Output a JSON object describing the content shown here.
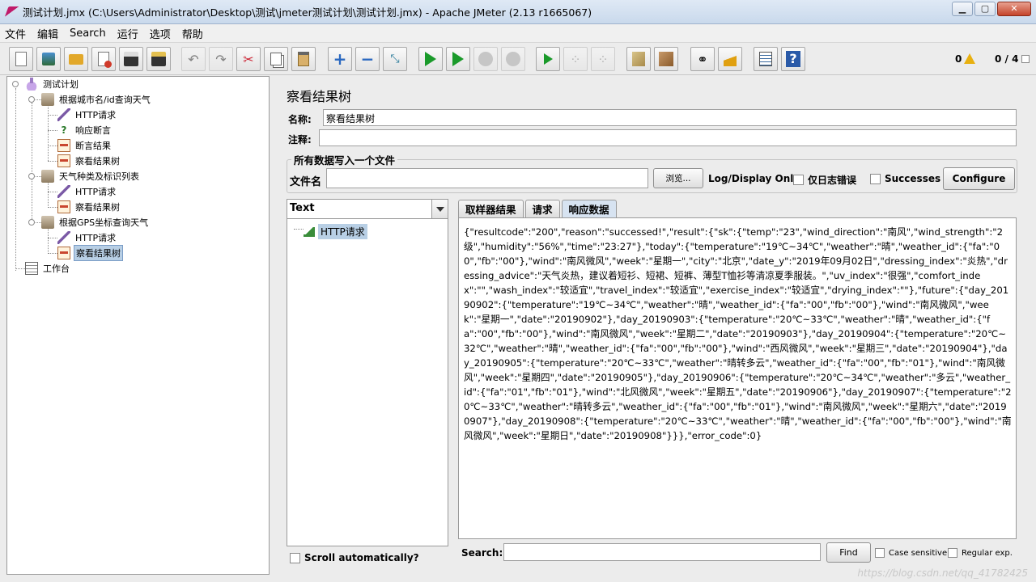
{
  "window": {
    "title": "测试计划.jmx (C:\\Users\\Administrator\\Desktop\\测试\\jmeter测试计划\\测试计划.jmx) - Apache JMeter (2.13 r1665067)",
    "min_label": "▁",
    "max_label": "▢",
    "close_label": "✕"
  },
  "menu": [
    "文件",
    "编辑",
    "Search",
    "运行",
    "选项",
    "帮助"
  ],
  "toolbar": {
    "buttons": [
      "new-icon",
      "templates-icon",
      "open-icon",
      "close-icon",
      "save-icon",
      "save-as-icon",
      "undo-icon",
      "redo-icon",
      "cut-icon",
      "copy-icon",
      "paste-icon",
      "expand-icon",
      "collapse-icon",
      "toggle-icon",
      "start-icon",
      "start-no-pause-icon",
      "stop-icon",
      "shutdown-icon",
      "remote-start-icon",
      "remote-stop-icon",
      "remote-shutdown-icon",
      "clear-icon",
      "clear-all-icon",
      "search-icon",
      "reset-search-icon",
      "function-helper-icon",
      "help-icon"
    ],
    "error_count": "0",
    "threads": "0 / 4"
  },
  "tree": {
    "plan": "测试计划",
    "group1": "根据城市名/id查询天气",
    "http1": "HTTP请求",
    "assert1": "响应断言",
    "assert_result1": "断言结果",
    "view1": "察看结果树",
    "group2": "天气种类及标识列表",
    "http2": "HTTP请求",
    "view2": "察看结果树",
    "group3": "根据GPS坐标查询天气",
    "http3": "HTTP请求",
    "view3": "察看结果树",
    "workbench": "工作台"
  },
  "panel": {
    "title": "察看结果树",
    "name_label": "名称:",
    "name_value": "察看结果树",
    "comment_label": "注释:",
    "comment_value": "",
    "file_group_title": "所有数据写入一个文件",
    "filename_label": "文件名",
    "filename_value": "",
    "browse_label": "浏览...",
    "log_only_label": "Log/Display Only:",
    "errors_only_label": "仅日志错误",
    "successes_label": "Successes",
    "configure_label": "Configure",
    "renderer": "Text",
    "sample_label": "HTTP请求",
    "tabs": [
      "取样器结果",
      "请求",
      "响应数据"
    ],
    "response_text": "{\"resultcode\":\"200\",\"reason\":\"successed!\",\"result\":{\"sk\":{\"temp\":\"23\",\"wind_direction\":\"南风\",\"wind_strength\":\"2级\",\"humidity\":\"56%\",\"time\":\"23:27\"},\"today\":{\"temperature\":\"19℃~34℃\",\"weather\":\"晴\",\"weather_id\":{\"fa\":\"00\",\"fb\":\"00\"},\"wind\":\"南风微风\",\"week\":\"星期一\",\"city\":\"北京\",\"date_y\":\"2019年09月02日\",\"dressing_index\":\"炎热\",\"dressing_advice\":\"天气炎热，建议着短衫、短裙、短裤、薄型T恤衫等清凉夏季服装。\",\"uv_index\":\"很强\",\"comfort_index\":\"\",\"wash_index\":\"较适宜\",\"travel_index\":\"较适宜\",\"exercise_index\":\"较适宜\",\"drying_index\":\"\"},\"future\":{\"day_20190902\":{\"temperature\":\"19℃~34℃\",\"weather\":\"晴\",\"weather_id\":{\"fa\":\"00\",\"fb\":\"00\"},\"wind\":\"南风微风\",\"week\":\"星期一\",\"date\":\"20190902\"},\"day_20190903\":{\"temperature\":\"20℃~33℃\",\"weather\":\"晴\",\"weather_id\":{\"fa\":\"00\",\"fb\":\"00\"},\"wind\":\"南风微风\",\"week\":\"星期二\",\"date\":\"20190903\"},\"day_20190904\":{\"temperature\":\"20℃~32℃\",\"weather\":\"晴\",\"weather_id\":{\"fa\":\"00\",\"fb\":\"00\"},\"wind\":\"西风微风\",\"week\":\"星期三\",\"date\":\"20190904\"},\"day_20190905\":{\"temperature\":\"20℃~33℃\",\"weather\":\"晴转多云\",\"weather_id\":{\"fa\":\"00\",\"fb\":\"01\"},\"wind\":\"南风微风\",\"week\":\"星期四\",\"date\":\"20190905\"},\"day_20190906\":{\"temperature\":\"20℃~34℃\",\"weather\":\"多云\",\"weather_id\":{\"fa\":\"01\",\"fb\":\"01\"},\"wind\":\"北风微风\",\"week\":\"星期五\",\"date\":\"20190906\"},\"day_20190907\":{\"temperature\":\"20℃~33℃\",\"weather\":\"晴转多云\",\"weather_id\":{\"fa\":\"00\",\"fb\":\"01\"},\"wind\":\"南风微风\",\"week\":\"星期六\",\"date\":\"20190907\"},\"day_20190908\":{\"temperature\":\"20℃~33℃\",\"weather\":\"晴\",\"weather_id\":{\"fa\":\"00\",\"fb\":\"00\"},\"wind\":\"南风微风\",\"week\":\"星期日\",\"date\":\"20190908\"}}},\"error_code\":0}",
    "scroll_auto_label": "Scroll automatically?",
    "search_label": "Search:",
    "find_label": "Find",
    "case_label": "Case sensitive",
    "regex_label": "Regular exp."
  },
  "watermark": "https://blog.csdn.net/qq_41782425"
}
